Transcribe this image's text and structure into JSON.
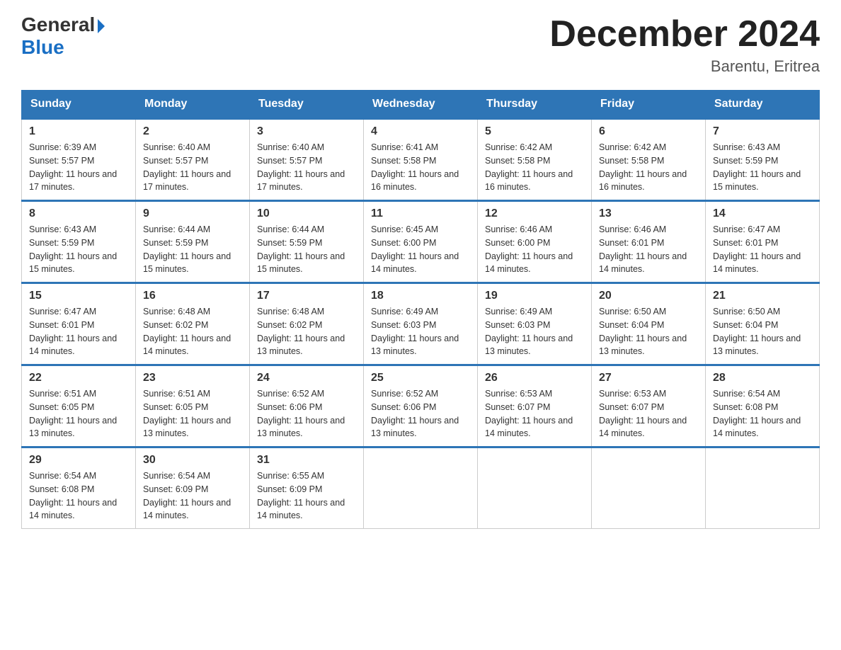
{
  "header": {
    "logo_general": "General",
    "logo_blue": "Blue",
    "month_title": "December 2024",
    "location": "Barentu, Eritrea"
  },
  "days_of_week": [
    "Sunday",
    "Monday",
    "Tuesday",
    "Wednesday",
    "Thursday",
    "Friday",
    "Saturday"
  ],
  "weeks": [
    [
      {
        "day": "1",
        "sunrise": "6:39 AM",
        "sunset": "5:57 PM",
        "daylight": "11 hours and 17 minutes."
      },
      {
        "day": "2",
        "sunrise": "6:40 AM",
        "sunset": "5:57 PM",
        "daylight": "11 hours and 17 minutes."
      },
      {
        "day": "3",
        "sunrise": "6:40 AM",
        "sunset": "5:57 PM",
        "daylight": "11 hours and 17 minutes."
      },
      {
        "day": "4",
        "sunrise": "6:41 AM",
        "sunset": "5:58 PM",
        "daylight": "11 hours and 16 minutes."
      },
      {
        "day": "5",
        "sunrise": "6:42 AM",
        "sunset": "5:58 PM",
        "daylight": "11 hours and 16 minutes."
      },
      {
        "day": "6",
        "sunrise": "6:42 AM",
        "sunset": "5:58 PM",
        "daylight": "11 hours and 16 minutes."
      },
      {
        "day": "7",
        "sunrise": "6:43 AM",
        "sunset": "5:59 PM",
        "daylight": "11 hours and 15 minutes."
      }
    ],
    [
      {
        "day": "8",
        "sunrise": "6:43 AM",
        "sunset": "5:59 PM",
        "daylight": "11 hours and 15 minutes."
      },
      {
        "day": "9",
        "sunrise": "6:44 AM",
        "sunset": "5:59 PM",
        "daylight": "11 hours and 15 minutes."
      },
      {
        "day": "10",
        "sunrise": "6:44 AM",
        "sunset": "5:59 PM",
        "daylight": "11 hours and 15 minutes."
      },
      {
        "day": "11",
        "sunrise": "6:45 AM",
        "sunset": "6:00 PM",
        "daylight": "11 hours and 14 minutes."
      },
      {
        "day": "12",
        "sunrise": "6:46 AM",
        "sunset": "6:00 PM",
        "daylight": "11 hours and 14 minutes."
      },
      {
        "day": "13",
        "sunrise": "6:46 AM",
        "sunset": "6:01 PM",
        "daylight": "11 hours and 14 minutes."
      },
      {
        "day": "14",
        "sunrise": "6:47 AM",
        "sunset": "6:01 PM",
        "daylight": "11 hours and 14 minutes."
      }
    ],
    [
      {
        "day": "15",
        "sunrise": "6:47 AM",
        "sunset": "6:01 PM",
        "daylight": "11 hours and 14 minutes."
      },
      {
        "day": "16",
        "sunrise": "6:48 AM",
        "sunset": "6:02 PM",
        "daylight": "11 hours and 14 minutes."
      },
      {
        "day": "17",
        "sunrise": "6:48 AM",
        "sunset": "6:02 PM",
        "daylight": "11 hours and 13 minutes."
      },
      {
        "day": "18",
        "sunrise": "6:49 AM",
        "sunset": "6:03 PM",
        "daylight": "11 hours and 13 minutes."
      },
      {
        "day": "19",
        "sunrise": "6:49 AM",
        "sunset": "6:03 PM",
        "daylight": "11 hours and 13 minutes."
      },
      {
        "day": "20",
        "sunrise": "6:50 AM",
        "sunset": "6:04 PM",
        "daylight": "11 hours and 13 minutes."
      },
      {
        "day": "21",
        "sunrise": "6:50 AM",
        "sunset": "6:04 PM",
        "daylight": "11 hours and 13 minutes."
      }
    ],
    [
      {
        "day": "22",
        "sunrise": "6:51 AM",
        "sunset": "6:05 PM",
        "daylight": "11 hours and 13 minutes."
      },
      {
        "day": "23",
        "sunrise": "6:51 AM",
        "sunset": "6:05 PM",
        "daylight": "11 hours and 13 minutes."
      },
      {
        "day": "24",
        "sunrise": "6:52 AM",
        "sunset": "6:06 PM",
        "daylight": "11 hours and 13 minutes."
      },
      {
        "day": "25",
        "sunrise": "6:52 AM",
        "sunset": "6:06 PM",
        "daylight": "11 hours and 13 minutes."
      },
      {
        "day": "26",
        "sunrise": "6:53 AM",
        "sunset": "6:07 PM",
        "daylight": "11 hours and 14 minutes."
      },
      {
        "day": "27",
        "sunrise": "6:53 AM",
        "sunset": "6:07 PM",
        "daylight": "11 hours and 14 minutes."
      },
      {
        "day": "28",
        "sunrise": "6:54 AM",
        "sunset": "6:08 PM",
        "daylight": "11 hours and 14 minutes."
      }
    ],
    [
      {
        "day": "29",
        "sunrise": "6:54 AM",
        "sunset": "6:08 PM",
        "daylight": "11 hours and 14 minutes."
      },
      {
        "day": "30",
        "sunrise": "6:54 AM",
        "sunset": "6:09 PM",
        "daylight": "11 hours and 14 minutes."
      },
      {
        "day": "31",
        "sunrise": "6:55 AM",
        "sunset": "6:09 PM",
        "daylight": "11 hours and 14 minutes."
      },
      null,
      null,
      null,
      null
    ]
  ]
}
